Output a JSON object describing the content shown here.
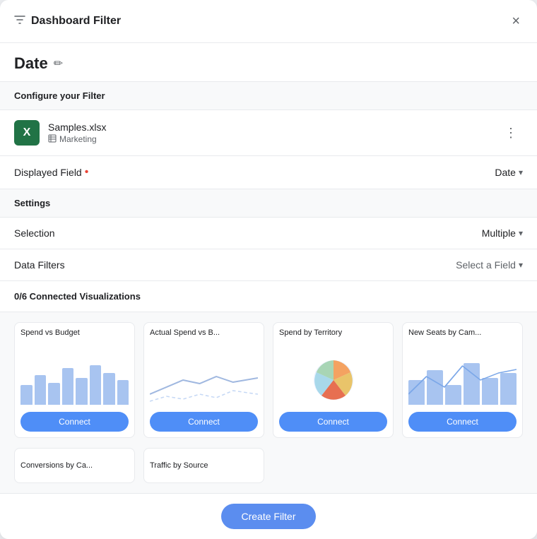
{
  "modal": {
    "title": "Dashboard Filter",
    "close_label": "×",
    "filter_name": "Date",
    "configure_label": "Configure your Filter",
    "edit_icon_label": "✏"
  },
  "datasource": {
    "name": "Samples.xlsx",
    "table": "Marketing",
    "more_icon": "⋮"
  },
  "displayed_field": {
    "label": "Displayed Field",
    "value": "Date",
    "required": true
  },
  "settings": {
    "label": "Settings",
    "selection": {
      "label": "Selection",
      "value": "Multiple"
    },
    "data_filters": {
      "label": "Data Filters",
      "value": "Select a Field"
    }
  },
  "visualizations": {
    "header": "0/6 Connected Visualizations",
    "cards": [
      {
        "title": "Spend vs Budget",
        "type": "bar",
        "connect_label": "Connect"
      },
      {
        "title": "Actual Spend vs B...",
        "type": "line",
        "connect_label": "Connect"
      },
      {
        "title": "Spend by Territory",
        "type": "pie",
        "connect_label": "Connect"
      },
      {
        "title": "New Seats by Cam...",
        "type": "bar-line",
        "connect_label": "Connect"
      }
    ],
    "partial_cards": [
      {
        "title": "Conversions by Ca..."
      },
      {
        "title": "Traffic by Source"
      }
    ]
  },
  "footer": {
    "create_filter_label": "Create Filter"
  },
  "colors": {
    "bar": "#a8c4f0",
    "bar_dark": "#7ba7e8",
    "line": "#a0b8e0",
    "connect_btn": "#4f8ef7",
    "create_btn": "#5b8def"
  }
}
